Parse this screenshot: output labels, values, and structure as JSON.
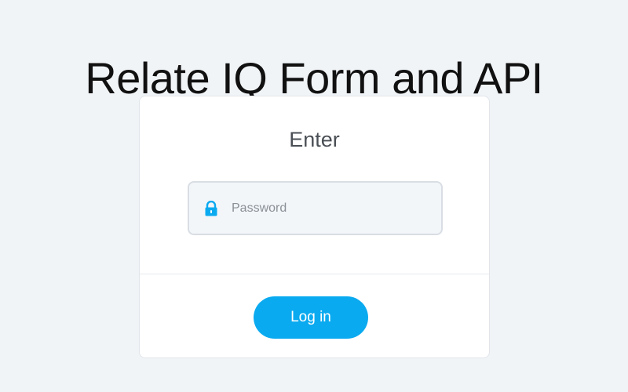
{
  "page": {
    "title": "Relate IQ Form and API"
  },
  "login_form": {
    "heading": "Enter",
    "password": {
      "placeholder": "Password",
      "value": "",
      "icon": "lock-icon"
    },
    "login_label": "Log in"
  },
  "colors": {
    "background": "#f1f4f7",
    "accent": "#0aaaf0",
    "card": "#ffffff",
    "input_background": "#f3f6f9"
  }
}
